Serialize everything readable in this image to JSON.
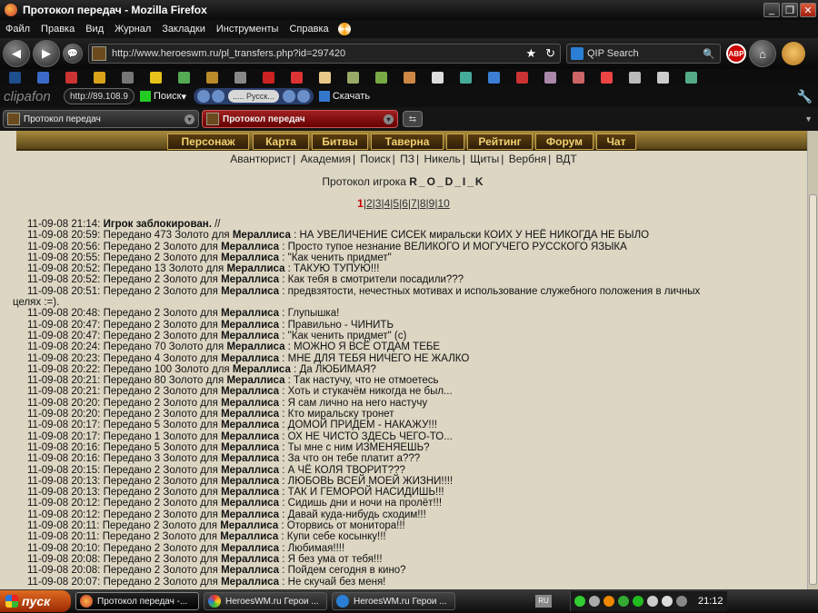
{
  "window": {
    "title": "Протокол передач - Mozilla Firefox"
  },
  "menu": [
    "Файл",
    "Правка",
    "Вид",
    "Журнал",
    "Закладки",
    "Инструменты",
    "Справка"
  ],
  "nav": {
    "url": "http://www.heroeswm.ru/pl_transfers.php?id=297420",
    "search_placeholder": "QIP Search",
    "abp": "ABP"
  },
  "clipbar": {
    "logo": "clipafon",
    "address": "http://89.108.9",
    "search": "Поиск",
    "player_text": "..... Русск...",
    "download": "Скачать"
  },
  "tabs": [
    {
      "label": "Протокол передач"
    },
    {
      "label": "Протокол передач"
    }
  ],
  "gamenav": [
    "Персонаж",
    "Карта",
    "Битвы",
    "Таверна",
    "",
    "Рейтинг",
    "Форум",
    "Чат"
  ],
  "sublinks": [
    "Авантюрист",
    "Академия",
    "Поиск",
    "ПЗ",
    "Никель",
    "Щиты",
    "Вербня",
    "ВДТ"
  ],
  "protocol": {
    "prefix": "Протокол игрока",
    "player": "R_O_D_I_K"
  },
  "pages": [
    "1",
    "2",
    "3",
    "4",
    "5",
    "6",
    "7",
    "8",
    "9",
    "10"
  ],
  "log": [
    {
      "time": "11-09-08 21:14:",
      "text": "",
      "bold_text": "Игрок заблокирован.",
      "tail": " //"
    },
    {
      "time": "11-09-08 20:59:",
      "text": "Передано 473 Золото для",
      "name": "Мераллиса",
      "msg": ": НА УВЕЛИЧЕНИЕ СИСЕК миральски КОИХ У НЕЁ НИКОГДА НЕ БЫЛО"
    },
    {
      "time": "11-09-08 20:56:",
      "text": "Передано 2 Золото для",
      "name": "Мераллиса",
      "msg": ": Просто тупое незнание ВЕЛИКОГО И МОГУЧЕГО РУССКОГО ЯЗЫКА"
    },
    {
      "time": "11-09-08 20:55:",
      "text": "Передано 2 Золото для",
      "name": "Мераллиса",
      "msg": ": \"Как ченить придмет\""
    },
    {
      "time": "11-09-08 20:52:",
      "text": "Передано 13 Золото для",
      "name": "Мераллиса",
      "msg": ": ТАКУЮ ТУПУЮ!!!"
    },
    {
      "time": "11-09-08 20:52:",
      "text": "Передано 2 Золото для",
      "name": "Мераллиса",
      "msg": ": Как тебя в смотрители посадили???"
    },
    {
      "time": "11-09-08 20:51:",
      "text": "Передано 2 Золото для",
      "name": "Мераллиса",
      "msg": ": предвзятости, нечестных мотивах и использование служебного положения в личных",
      "cont": "целях :=)."
    },
    {
      "time": "11-09-08 20:48:",
      "text": "Передано 2 Золото для",
      "name": "Мераллиса",
      "msg": ": Глупышка!"
    },
    {
      "time": "11-09-08 20:47:",
      "text": "Передано 2 Золото для",
      "name": "Мераллиса",
      "msg": ": Правильно - ЧИНИТЬ"
    },
    {
      "time": "11-09-08 20:47:",
      "text": "Передано 2 Золото для",
      "name": "Мераллиса",
      "msg": ": \"Как ченить придмет\" (с)"
    },
    {
      "time": "11-09-08 20:24:",
      "text": "Передано 70 Золото для",
      "name": "Мераллиса",
      "msg": ": МОЖНО Я ВСЁ ОТДАМ ТЕБЕ"
    },
    {
      "time": "11-09-08 20:23:",
      "text": "Передано 4 Золото для",
      "name": "Мераллиса",
      "msg": ": МНЕ ДЛЯ ТЕБЯ НИЧЕГО НЕ ЖАЛКО"
    },
    {
      "time": "11-09-08 20:22:",
      "text": "Передано 100 Золото для",
      "name": "Мераллиса",
      "msg": ": Да ЛЮБИМАЯ?"
    },
    {
      "time": "11-09-08 20:21:",
      "text": "Передано 80 Золото для",
      "name": "Мераллиса",
      "msg": ": Так настучу, что не отмоетесь"
    },
    {
      "time": "11-09-08 20:21:",
      "text": "Передано 2 Золото для",
      "name": "Мераллиса",
      "msg": ": Хоть и стукачём никогда не был..."
    },
    {
      "time": "11-09-08 20:20:",
      "text": "Передано 2 Золото для",
      "name": "Мераллиса",
      "msg": ": Я сам лично на него настучу"
    },
    {
      "time": "11-09-08 20:20:",
      "text": "Передано 2 Золото для",
      "name": "Мераллиса",
      "msg": ": Кто миральску тронет"
    },
    {
      "time": "11-09-08 20:17:",
      "text": "Передано 5 Золото для",
      "name": "Мераллиса",
      "msg": ": ДОМОЙ ПРИДЕМ - НАКАЖУ!!!"
    },
    {
      "time": "11-09-08 20:17:",
      "text": "Передано 1 Золото для",
      "name": "Мераллиса",
      "msg": ": ОХ НЕ ЧИСТО ЗДЕСЬ ЧЕГО-ТО..."
    },
    {
      "time": "11-09-08 20:16:",
      "text": "Передано 5 Золото для",
      "name": "Мераллиса",
      "msg": ": Ты мне с ним ИЗМЕНЯЕШЬ?"
    },
    {
      "time": "11-09-08 20:16:",
      "text": "Передано 3 Золото для",
      "name": "Мераллиса",
      "msg": ": За что он тебе платит а???"
    },
    {
      "time": "11-09-08 20:15:",
      "text": "Передано 2 Золото для",
      "name": "Мераллиса",
      "msg": ": А ЧЁ КОЛЯ ТВОРИТ???"
    },
    {
      "time": "11-09-08 20:13:",
      "text": "Передано 2 Золото для",
      "name": "Мераллиса",
      "msg": ": ЛЮБОВЬ ВСЕЙ МОЕЙ ЖИЗНИ!!!!"
    },
    {
      "time": "11-09-08 20:13:",
      "text": "Передано 2 Золото для",
      "name": "Мераллиса",
      "msg": ": ТАК И ГЕМОРОЙ НАСИДИШЬ!!!"
    },
    {
      "time": "11-09-08 20:12:",
      "text": "Передано 2 Золото для",
      "name": "Мераллиса",
      "msg": ": Сидишь дни и ночи на пролёт!!!"
    },
    {
      "time": "11-09-08 20:12:",
      "text": "Передано 2 Золото для",
      "name": "Мераллиса",
      "msg": ": Давай куда-нибудь сходим!!!"
    },
    {
      "time": "11-09-08 20:11:",
      "text": "Передано 2 Золото для",
      "name": "Мераллиса",
      "msg": ": Оторвись от монитора!!!"
    },
    {
      "time": "11-09-08 20:11:",
      "text": "Передано 2 Золото для",
      "name": "Мераллиса",
      "msg": ": Купи себе косынку!!!"
    },
    {
      "time": "11-09-08 20:10:",
      "text": "Передано 2 Золото для",
      "name": "Мераллиса",
      "msg": ": Любимая!!!!"
    },
    {
      "time": "11-09-08 20:08:",
      "text": "Передано 2 Золото для",
      "name": "Мераллиса",
      "msg": ": Я без ума от тебя!!!"
    },
    {
      "time": "11-09-08 20:08:",
      "text": "Передано 2 Золото для",
      "name": "Мераллиса",
      "msg": ": Пойдем сегодня в кино?"
    },
    {
      "time": "11-09-08 20:07:",
      "text": "Передано 2 Золото для",
      "name": "Мераллиса",
      "msg": ": Не скучай без меня!"
    }
  ],
  "taskbar": {
    "start": "пуск",
    "tasks": [
      "Протокол передач -...",
      "HeroesWM.ru Герои ...",
      "HeroesWM.ru Герои ..."
    ],
    "lang": "RU",
    "clock": "21:12"
  }
}
